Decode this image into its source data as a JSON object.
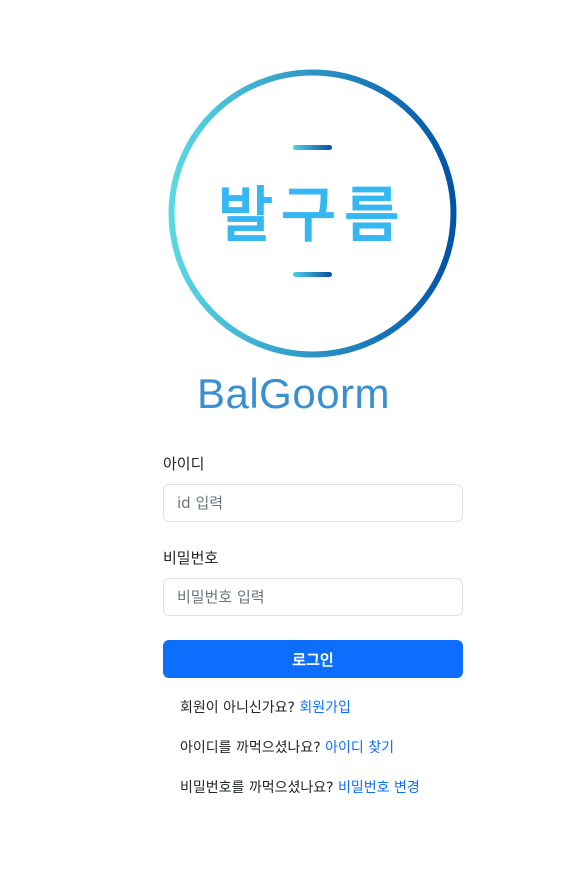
{
  "logo": {
    "korean_text": "발구름",
    "ring_colors": [
      "#5ad8e3",
      "#0053a8"
    ],
    "text_color": "#35b8f2"
  },
  "brand": {
    "name": "BalGoorm"
  },
  "form": {
    "id_label": "아이디",
    "id_placeholder": "id 입력",
    "password_label": "비밀번호",
    "password_placeholder": "비밀번호 입력",
    "login_button": "로그인"
  },
  "links": {
    "signup_prompt": "회원이 아니신가요?",
    "signup_link": "회원가입",
    "find_id_prompt": "아이디를 까먹으셨나요?",
    "find_id_link": "아이디 찾기",
    "reset_pw_prompt": "비밀번호를 까먹으셨나요?",
    "reset_pw_link": "비밀번호 변경"
  },
  "colors": {
    "primary": "#0d6efd",
    "brand": "#3a8fd0"
  }
}
